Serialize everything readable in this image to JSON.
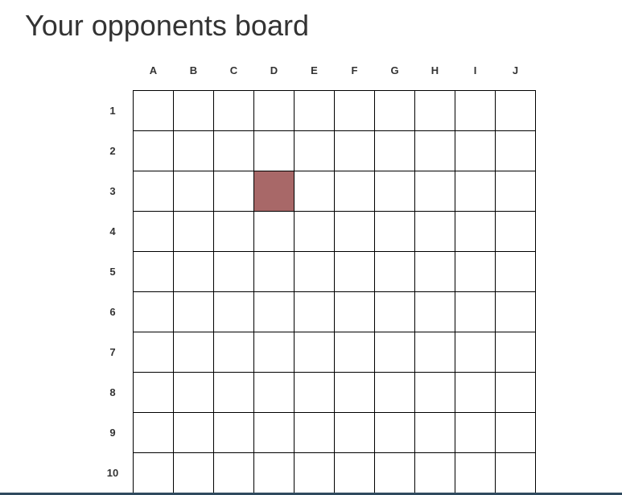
{
  "header": {
    "title": "Your opponents board"
  },
  "board": {
    "columns": [
      "A",
      "B",
      "C",
      "D",
      "E",
      "F",
      "G",
      "H",
      "I",
      "J"
    ],
    "rows": [
      "1",
      "2",
      "3",
      "4",
      "5",
      "6",
      "7",
      "8",
      "9",
      "10"
    ],
    "marked_cells": [
      {
        "row": "3",
        "col": "D",
        "state": "hit"
      }
    ],
    "colors": {
      "hit": "#a86868",
      "empty": "#ffffff",
      "grid_line": "#000000"
    }
  }
}
